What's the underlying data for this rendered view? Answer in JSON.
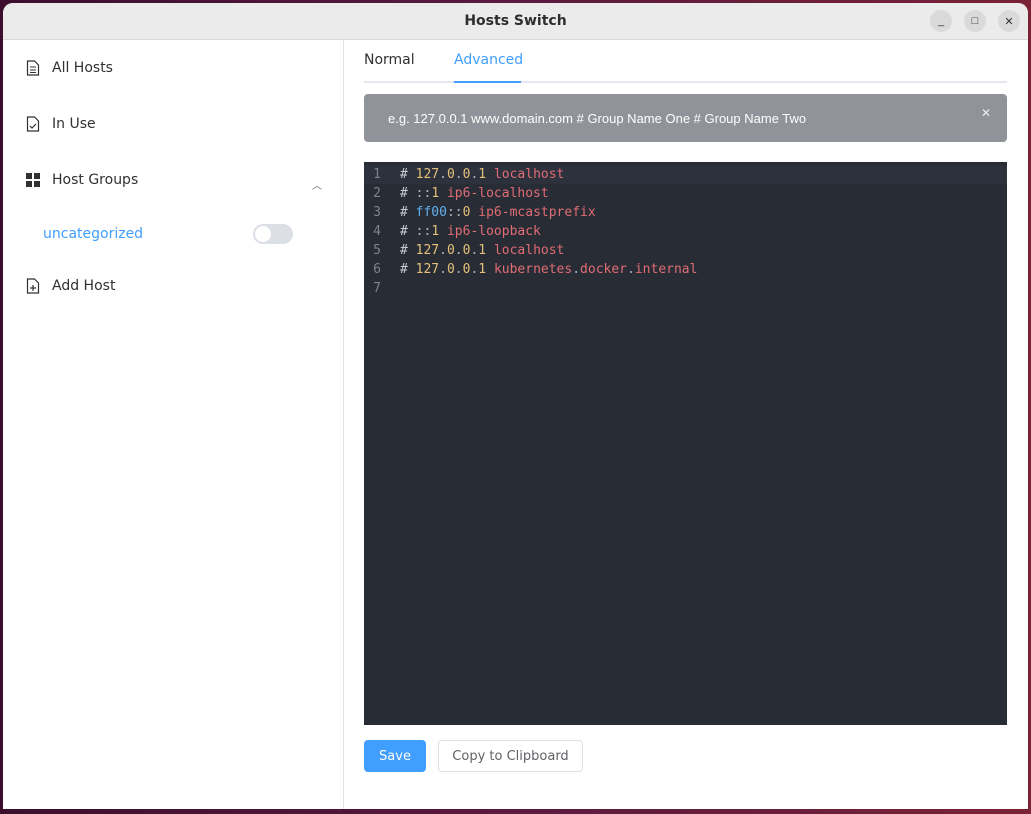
{
  "window": {
    "title": "Hosts Switch",
    "controls": {
      "minimize": "_",
      "maximize": "□",
      "close": "✕"
    }
  },
  "sidebar": {
    "items": [
      {
        "label": "All Hosts",
        "icon": "document-icon"
      },
      {
        "label": "In Use",
        "icon": "document-check-icon"
      },
      {
        "label": "Host Groups",
        "icon": "grid-icon",
        "expanded": true
      },
      {
        "label": "Add Host",
        "icon": "document-add-icon"
      }
    ],
    "groups": [
      {
        "label": "uncategorized",
        "enabled": false
      }
    ]
  },
  "tabs": [
    {
      "label": "Normal",
      "active": false
    },
    {
      "label": "Advanced",
      "active": true
    }
  ],
  "alert": {
    "text": "e.g. 127.0.0.1 www.domain.com # Group Name One # Group Name Two",
    "close": "✕"
  },
  "editor": {
    "lines": [
      {
        "n": "1",
        "text": "# 127.0.0.1 localhost"
      },
      {
        "n": "2",
        "text": "# ::1 ip6-localhost"
      },
      {
        "n": "3",
        "text": "# ff00::0 ip6-mcastprefix"
      },
      {
        "n": "4",
        "text": "# ::1 ip6-loopback"
      },
      {
        "n": "5",
        "text": "# 127.0.0.1 localhost"
      },
      {
        "n": "6",
        "text": "# 127.0.0.1 kubernetes.docker.internal"
      },
      {
        "n": "7",
        "text": ""
      }
    ]
  },
  "buttons": {
    "save": "Save",
    "copy": "Copy to Clipboard"
  },
  "colors": {
    "accent": "#409eff",
    "alert_bg": "#909399",
    "editor_bg": "#282c34"
  }
}
